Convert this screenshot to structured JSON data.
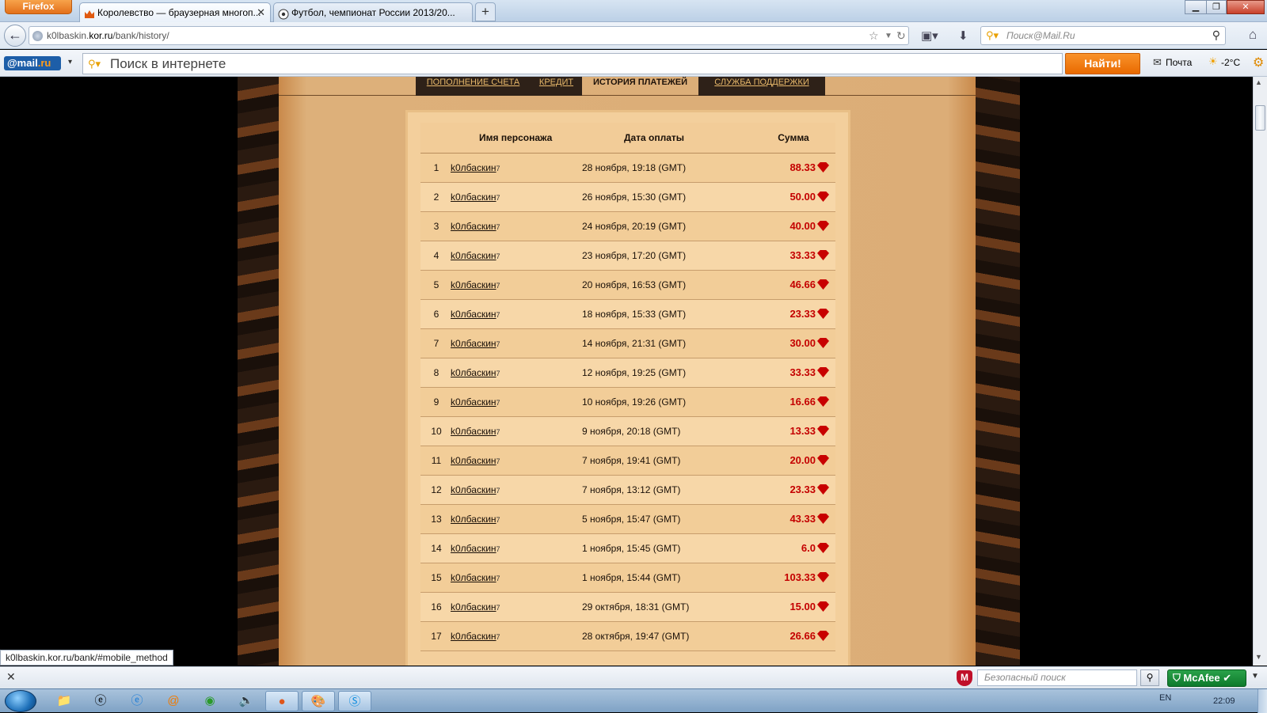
{
  "browser": {
    "app_button": "Firefox",
    "tabs": [
      {
        "title": "Королевство — браузерная многоп...",
        "active": true
      },
      {
        "title": "Футбол, чемпионат России 2013/20...",
        "active": false
      }
    ],
    "new_tab": "+",
    "url_host": "k0lbaskin.kor.ru",
    "url_path": "/bank/history/",
    "url_prefix": "k0lbaskin.",
    "url_domain": "kor.ru",
    "search_placeholder": "Поиск@Mail.Ru"
  },
  "mailru_toolbar": {
    "logo_at": "@mail",
    "logo_ru": ".ru",
    "search_placeholder": "Поиск в интернете",
    "find_button": "Найти!",
    "mail_link": "Почта",
    "weather": "-2°C"
  },
  "site_nav": {
    "tabs": [
      {
        "label": "Пополнение счета",
        "active": false
      },
      {
        "label": "Кредит",
        "active": false
      },
      {
        "label": "История платежей",
        "active": true
      },
      {
        "label": "Служба поддержки",
        "active": false
      }
    ]
  },
  "history": {
    "columns": [
      "",
      "Имя персонажа",
      "Дата оплаты",
      "Сумма"
    ],
    "rows": [
      {
        "n": "1",
        "name": "k0лбаскин",
        "sup": "7",
        "date": "28 ноября, 19:18 (GMT)",
        "sum": "88.33"
      },
      {
        "n": "2",
        "name": "k0лбаскин",
        "sup": "7",
        "date": "26 ноября, 15:30 (GMT)",
        "sum": "50.00"
      },
      {
        "n": "3",
        "name": "k0лбаскин",
        "sup": "7",
        "date": "24 ноября, 20:19 (GMT)",
        "sum": "40.00"
      },
      {
        "n": "4",
        "name": "k0лбаскин",
        "sup": "7",
        "date": "23 ноября, 17:20 (GMT)",
        "sum": "33.33"
      },
      {
        "n": "5",
        "name": "k0лбаскин",
        "sup": "7",
        "date": "20 ноября, 16:53 (GMT)",
        "sum": "46.66"
      },
      {
        "n": "6",
        "name": "k0лбаскин",
        "sup": "7",
        "date": "18 ноября, 15:33 (GMT)",
        "sum": "23.33"
      },
      {
        "n": "7",
        "name": "k0лбаскин",
        "sup": "7",
        "date": "14 ноября, 21:31 (GMT)",
        "sum": "30.00"
      },
      {
        "n": "8",
        "name": "k0лбаскин",
        "sup": "7",
        "date": "12 ноября, 19:25 (GMT)",
        "sum": "33.33"
      },
      {
        "n": "9",
        "name": "k0лбаскин",
        "sup": "7",
        "date": "10 ноября, 19:26 (GMT)",
        "sum": "16.66"
      },
      {
        "n": "10",
        "name": "k0лбаскин",
        "sup": "7",
        "date": "9 ноября, 20:18 (GMT)",
        "sum": "13.33"
      },
      {
        "n": "11",
        "name": "k0лбаскин",
        "sup": "7",
        "date": "7 ноября, 19:41 (GMT)",
        "sum": "20.00"
      },
      {
        "n": "12",
        "name": "k0лбаскин",
        "sup": "7",
        "date": "7 ноября, 13:12 (GMT)",
        "sum": "23.33"
      },
      {
        "n": "13",
        "name": "k0лбаскин",
        "sup": "7",
        "date": "5 ноября, 15:47 (GMT)",
        "sum": "43.33"
      },
      {
        "n": "14",
        "name": "k0лбаскин",
        "sup": "7",
        "date": "1 ноября, 15:45 (GMT)",
        "sum": "6.0"
      },
      {
        "n": "15",
        "name": "k0лбаскин",
        "sup": "7",
        "date": "1 ноября, 15:44 (GMT)",
        "sum": "103.33"
      },
      {
        "n": "16",
        "name": "k0лбаскин",
        "sup": "7",
        "date": "29 октября, 18:31 (GMT)",
        "sum": "15.00"
      },
      {
        "n": "17",
        "name": "k0лбаскин",
        "sup": "7",
        "date": "28 октября, 19:47 (GMT)",
        "sum": "26.66"
      }
    ]
  },
  "status_link": "k0lbaskin.kor.ru/bank/#mobile_method",
  "addon_bar": {
    "safe_search_placeholder": "Безопасный поиск",
    "mcafee_label": "McAfee"
  },
  "taskbar": {
    "lang": "EN",
    "clock": "22:09",
    "icons": [
      "explorer-icon",
      "ie-icon",
      "ie-icon",
      "mail-agent-icon",
      "chrome-icon",
      "volume-icon",
      "firefox-icon",
      "paint-icon",
      "skype-icon"
    ]
  },
  "colors": {
    "sum_red": "#c40000",
    "find_orange": "#f07a10",
    "parchment": "#f3cf9c"
  }
}
